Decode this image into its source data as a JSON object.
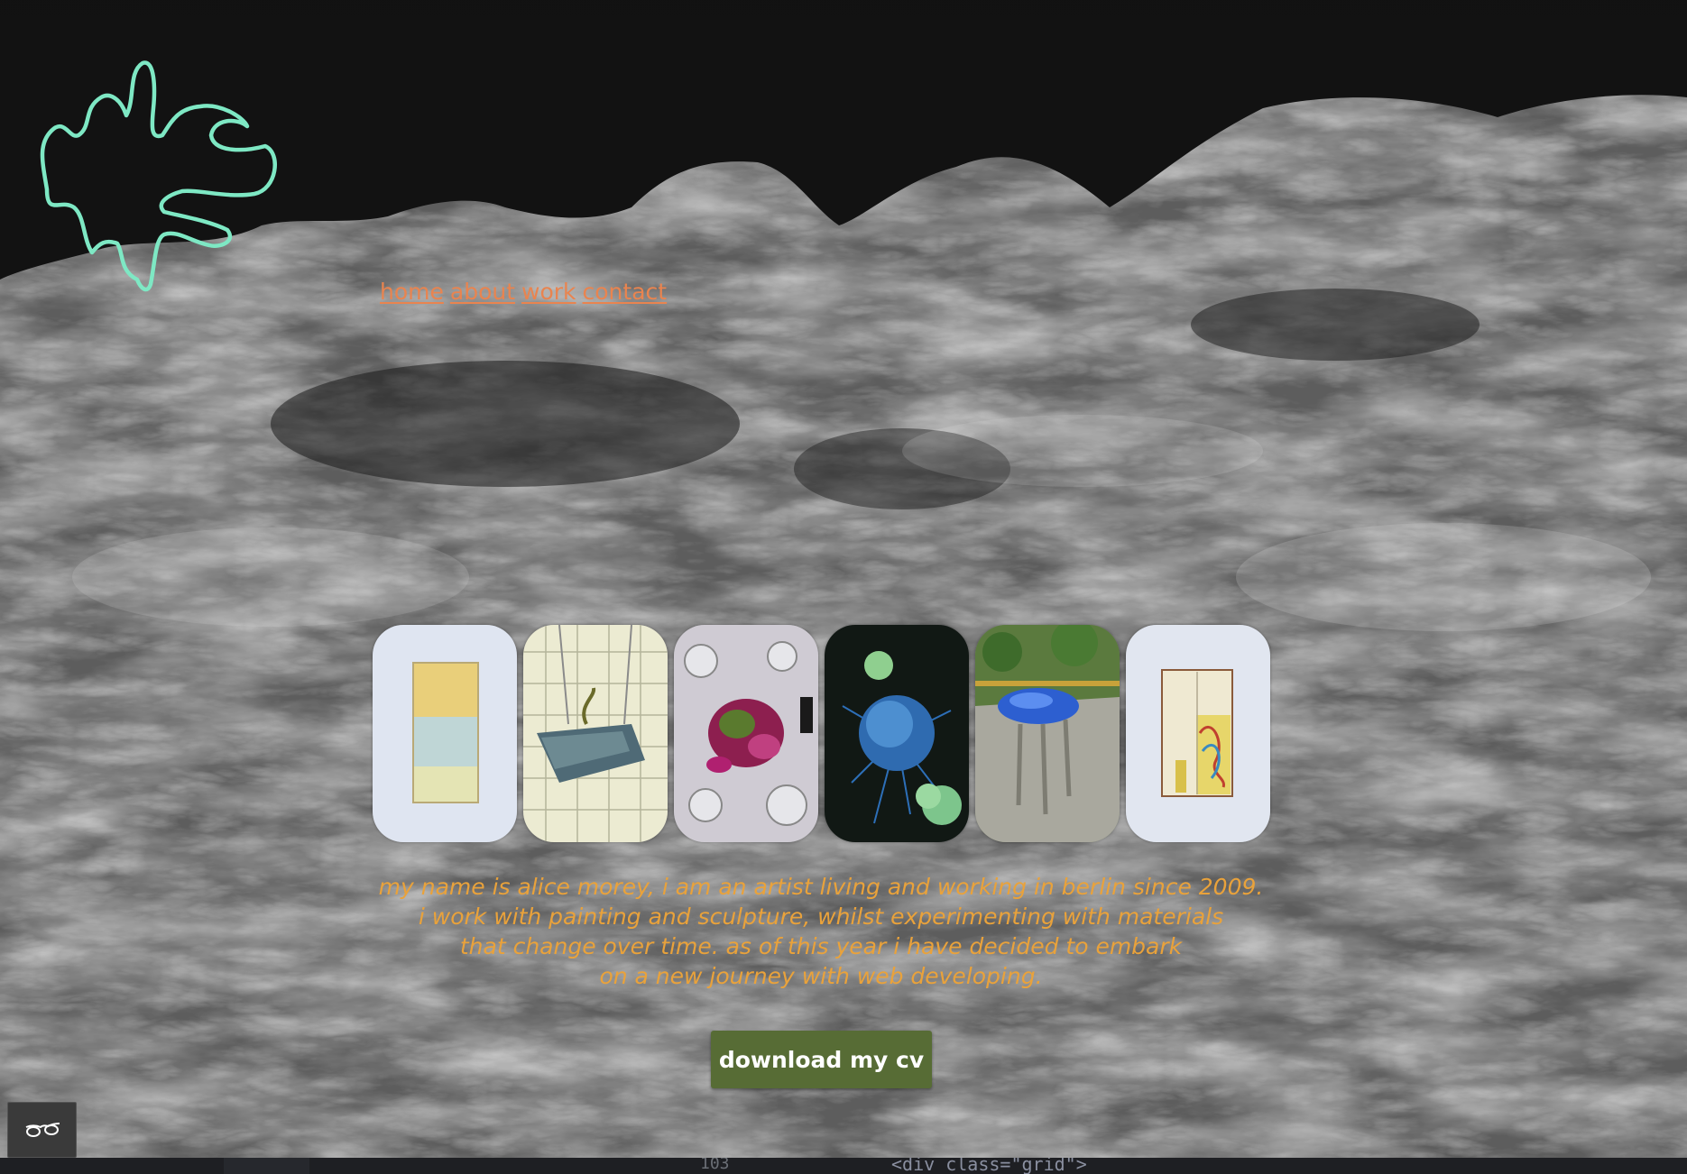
{
  "nav": {
    "links": [
      "home",
      "about",
      "work",
      "contact"
    ]
  },
  "gallery": {
    "items": [
      {
        "label": "painting-1"
      },
      {
        "label": "sculpture-hanging"
      },
      {
        "label": "table-installation"
      },
      {
        "label": "blue-organism"
      },
      {
        "label": "blue-sculpture-outdoor"
      },
      {
        "label": "painting-2"
      }
    ]
  },
  "bio": {
    "lines": [
      "my name is alice morey, i am an artist living and working in berlin since 2009.",
      "i work with painting and sculpture, whilst experimenting with materials",
      "that change over time. as of this year i have decided to embark",
      "on a new journey with web developing."
    ]
  },
  "cv_button": {
    "label": "download my cv"
  },
  "reader_button": {
    "icon": "glasses-icon"
  },
  "editor_strip": {
    "line_number": "103",
    "code": "<div class=\"grid\">"
  },
  "colors": {
    "nav_link": "#e9844f",
    "bio_text": "#e9a23b",
    "button_bg": "#576c35",
    "logo_stroke": "#7ee8c4"
  }
}
